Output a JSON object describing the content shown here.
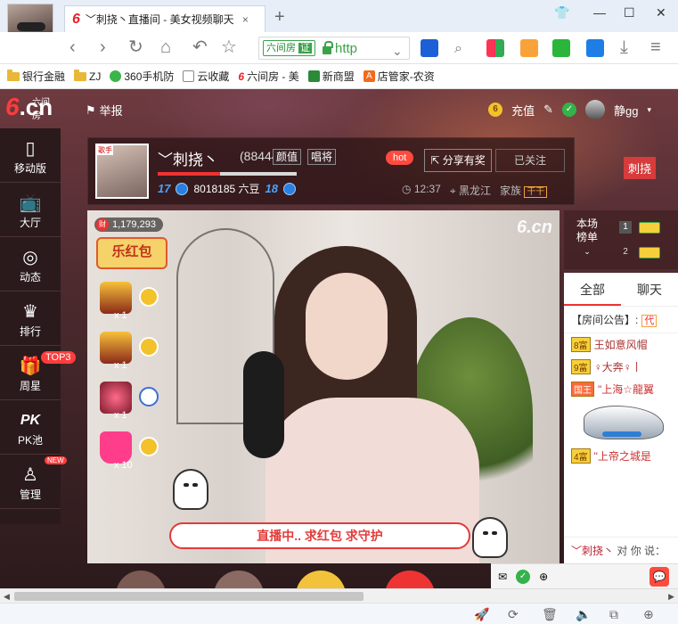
{
  "browser": {
    "tab_title": "﹀刺挠丶直播间 - 美女视频聊天",
    "tab_close": "×",
    "new_tab": "+",
    "address": {
      "site_name": "六间房",
      "site_badge": "证",
      "protocol": "http"
    },
    "bookmarks": [
      {
        "label": "银行金融",
        "icon": "folder-icon"
      },
      {
        "label": "ZJ",
        "icon": "folder-icon"
      },
      {
        "label": "360手机防",
        "icon": "360-icon"
      },
      {
        "label": "云收藏",
        "icon": "page-icon"
      },
      {
        "label": "六间房 - 美",
        "icon": "six-icon"
      },
      {
        "label": "新商盟",
        "icon": "leaf-icon"
      },
      {
        "label": "店管家-农资",
        "icon": "a-icon"
      }
    ]
  },
  "site": {
    "logo_six": "6",
    "logo_cn": ".cn",
    "logo_sub": "六间房",
    "report_label": "举报",
    "recharge_label": "充值",
    "username": "静gg",
    "sidebar": [
      {
        "label": "移动版",
        "icon": "phone-icon"
      },
      {
        "label": "大厅",
        "icon": "tv-icon"
      },
      {
        "label": "动态",
        "icon": "compass-icon"
      },
      {
        "label": "排行",
        "icon": "crown-icon"
      },
      {
        "label": "周星",
        "icon": "gift-icon",
        "badge": "TOP3"
      },
      {
        "label": "PK池",
        "icon": "pk-icon",
        "glyph": "PK"
      },
      {
        "label": "管理",
        "icon": "manage-icon",
        "badge": "NEW"
      }
    ]
  },
  "anchor": {
    "name": "﹀刺挠丶",
    "id": "(884440)",
    "tags": [
      "颜值",
      "唱将"
    ],
    "level_left": "17",
    "beans": "8018185 六豆",
    "level_right": "18",
    "hot_label": "hot",
    "share_label": "分享有奖",
    "follow_label": "已关注",
    "time": "12:37",
    "location": "黑龙江",
    "family_label": "家族",
    "family_badge": "干干",
    "top_name": "刺挠",
    "progress_fraction": 0.45
  },
  "video": {
    "logo": "6.cn",
    "redpacket_label": "财",
    "redpacket_count": "1,179,293",
    "banner_text": "乐红包",
    "gifts": [
      {
        "count": "x 1"
      },
      {
        "count": "x 1"
      },
      {
        "count": "x 1"
      },
      {
        "count": "x 10"
      }
    ],
    "live_banner": "直播中.. 求红包  求守护"
  },
  "rank": {
    "title_line1": "本场",
    "title_line2": "榜单",
    "rows": [
      {
        "num": "1"
      },
      {
        "num": "2"
      }
    ]
  },
  "chat": {
    "tabs": [
      "全部",
      "聊天"
    ],
    "notice_label": "【房间公告】:",
    "notice_tag": "代",
    "messages": [
      {
        "level": "8富",
        "text": "王如意风帽"
      },
      {
        "level": "9富",
        "text": "♀大奔♀丨"
      },
      {
        "level": "国王",
        "text": "\"上海☆龍翼"
      },
      {
        "level": "4富",
        "text": "\"上帝之城是"
      }
    ],
    "footer_name": "﹀刺挠丶",
    "footer_to": "对 你 说："
  },
  "colors": {
    "accent": "#e8222b",
    "header_bg": "#3a1f22",
    "green": "#3aa34a"
  }
}
